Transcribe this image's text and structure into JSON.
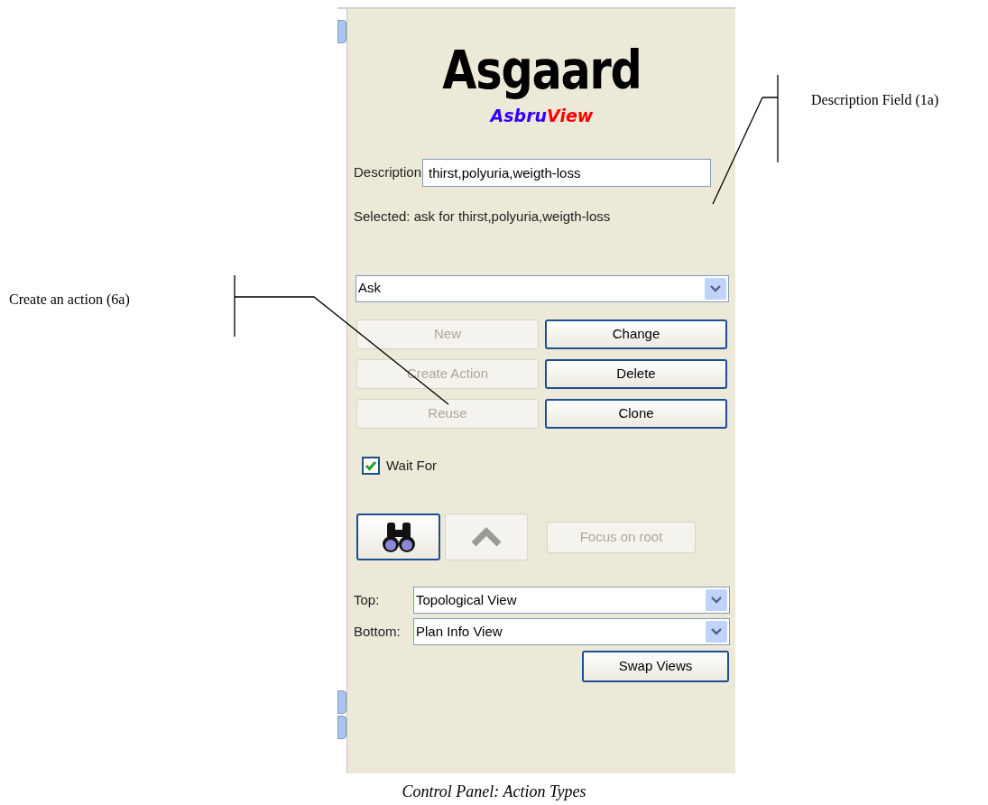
{
  "annotations": [
    {
      "text": "Description Field  (1a)"
    },
    {
      "text": "Create an action (6a)"
    }
  ],
  "logo": {
    "title": "Asgaard",
    "subtitle": [
      "Asbru",
      "View"
    ]
  },
  "description": {
    "label": "Description",
    "value": "thirst,polyuria,weigth-loss"
  },
  "selected_text": "Selected: ask for thirst,polyuria,weigth-loss",
  "action_type": {
    "value": "Ask"
  },
  "buttons": [
    {
      "label": "New",
      "disabled": true
    },
    {
      "label": "Change",
      "disabled": false
    },
    {
      "label": "Create Action",
      "disabled": true
    },
    {
      "label": "Delete",
      "disabled": false
    },
    {
      "label": "Reuse",
      "disabled": true
    },
    {
      "label": "Clone",
      "disabled": false
    }
  ],
  "wait_for": {
    "label": "Wait For",
    "checked": true
  },
  "tools": [
    {
      "kind": "binoculars",
      "disabled": false
    },
    {
      "kind": "up",
      "disabled": true
    },
    {
      "kind": "text",
      "label": "Focus on root",
      "disabled": true
    }
  ],
  "views": [
    {
      "label": "Top:",
      "value": "Topological View"
    },
    {
      "label": "Bottom:",
      "value": "Plan Info View"
    }
  ],
  "swap_button": "Swap Views",
  "caption": "Control Panel: Action Types"
}
